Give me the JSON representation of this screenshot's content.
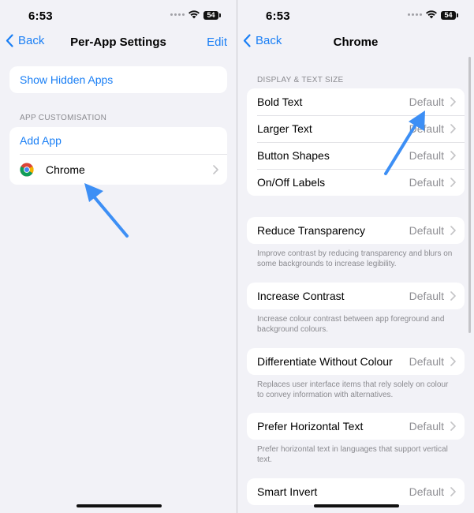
{
  "status_bar": {
    "time": "6:53",
    "battery": "54"
  },
  "left": {
    "nav": {
      "back": "Back",
      "title": "Per-App Settings",
      "edit": "Edit"
    },
    "show_hidden_apps": "Show Hidden Apps",
    "section_label": "APP CUSTOMISATION",
    "add_app": "Add App",
    "apps": [
      {
        "name": "Chrome",
        "icon": "chrome-icon"
      }
    ]
  },
  "right": {
    "nav": {
      "back": "Back",
      "title": "Chrome"
    },
    "section_label": "DISPLAY & TEXT SIZE",
    "display_rows": [
      {
        "label": "Bold Text",
        "value": "Default"
      },
      {
        "label": "Larger Text",
        "value": "Default"
      },
      {
        "label": "Button Shapes",
        "value": "Default"
      },
      {
        "label": "On/Off Labels",
        "value": "Default"
      }
    ],
    "settings": [
      {
        "label": "Reduce Transparency",
        "value": "Default",
        "footer": "Improve contrast by reducing transparency and blurs on some backgrounds to increase legibility."
      },
      {
        "label": "Increase Contrast",
        "value": "Default",
        "footer": "Increase colour contrast between app foreground and background colours."
      },
      {
        "label": "Differentiate Without Colour",
        "value": "Default",
        "footer": "Replaces user interface items that rely solely on colour to convey information with alternatives."
      },
      {
        "label": "Prefer Horizontal Text",
        "value": "Default",
        "footer": "Prefer horizontal text in languages that support vertical text."
      },
      {
        "label": "Smart Invert",
        "value": "Default"
      }
    ]
  },
  "colors": {
    "accent": "#1a7ff5",
    "annotation_arrow": "#3d8ff5",
    "background": "#f2f2f7"
  }
}
